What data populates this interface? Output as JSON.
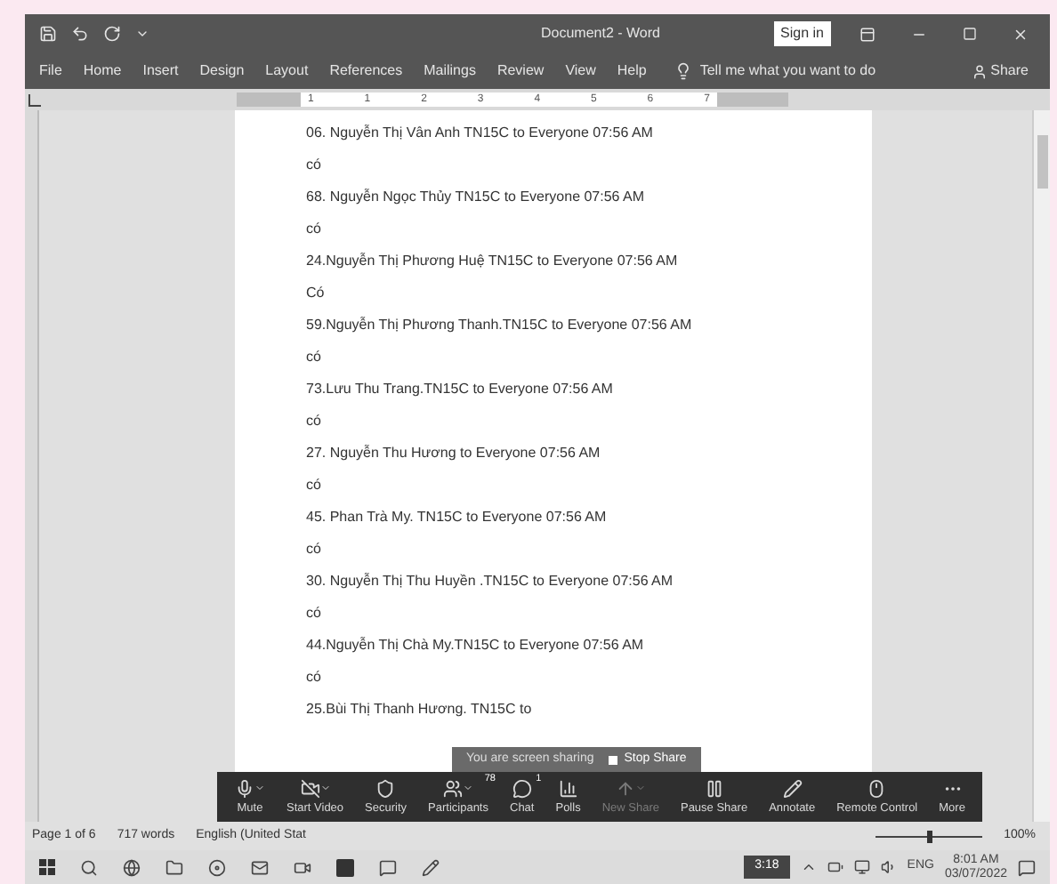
{
  "title_bar": {
    "title": "Document2 - Word",
    "sign_in": "Sign in"
  },
  "ribbon_tabs": [
    "File",
    "Home",
    "Insert",
    "Design",
    "Layout",
    "References",
    "Mailings",
    "Review",
    "View",
    "Help"
  ],
  "tell_me": "Tell me what you want to do",
  "share": "Share",
  "ruler_labels": [
    "1",
    "1",
    "2",
    "3",
    "4",
    "5",
    "6",
    "7"
  ],
  "document": {
    "lines": [
      "06. Nguyễn Thị Vân Anh TN15C to Everyone 07:56 AM",
      "có",
      "68. Nguyễn Ngọc Thủy TN15C to Everyone 07:56 AM",
      "có",
      "24.Nguyễn Thị Phương Huệ TN15C to Everyone 07:56 AM",
      "Có",
      "59.Nguyễn Thị Phương Thanh.TN15C to Everyone 07:56 AM",
      "có",
      "73.Lưu Thu Trang.TN15C to Everyone 07:56 AM",
      "có",
      "27. Nguyễn Thu Hương to Everyone 07:56 AM",
      "có",
      "45. Phan Trà My. TN15C to Everyone 07:56 AM",
      "có",
      "30. Nguyễn Thị Thu Huyền .TN15C to Everyone 07:56 AM",
      "có",
      "44.Nguyễn Thị Chà My.TN15C to Everyone 07:56 AM",
      "có",
      "25.Bùi Thị Thanh Hương. TN15C to"
    ]
  },
  "status_bar": {
    "page": "Page 1 of 6",
    "words": "717 words",
    "language": "English (United Stat",
    "zoom_slider": {
      "level": 0.5
    },
    "zoom": "100%"
  },
  "sharing_banner": {
    "text": "You are screen sharing",
    "stop": "Stop Share"
  },
  "meeting_toolbar": [
    {
      "kind": "mic",
      "label": "Mute",
      "caret": true,
      "disabled": false
    },
    {
      "kind": "video",
      "label": "Start Video",
      "caret": true,
      "disabled": false
    },
    {
      "kind": "shield",
      "label": "Security",
      "caret": false,
      "disabled": false
    },
    {
      "kind": "people",
      "label": "Participants",
      "badge": "78",
      "caret": true,
      "disabled": false
    },
    {
      "kind": "chat",
      "label": "Chat",
      "badge": "1",
      "caret": false,
      "disabled": false
    },
    {
      "kind": "polls",
      "label": "Polls",
      "caret": false,
      "disabled": false
    },
    {
      "kind": "share",
      "label": "New Share",
      "caret": true,
      "disabled": true
    },
    {
      "kind": "pause",
      "label": "Pause Share",
      "caret": false,
      "disabled": false
    },
    {
      "kind": "pen",
      "label": "Annotate",
      "caret": false,
      "disabled": false
    },
    {
      "kind": "mouse",
      "label": "Remote Control",
      "caret": false,
      "disabled": false
    },
    {
      "kind": "more",
      "label": "More",
      "caret": false,
      "disabled": false
    }
  ],
  "taskbar": {
    "timer": "3:18",
    "language": "ENG",
    "time": "8:01 AM",
    "date": "03/07/2022"
  }
}
